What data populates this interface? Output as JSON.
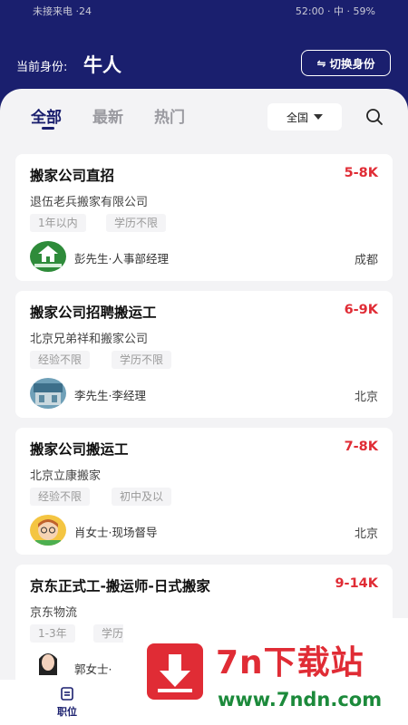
{
  "status": {
    "left": "未接来电 ·24",
    "right": "52:00 · 中 · 59%"
  },
  "header": {
    "identity_label": "当前身份:",
    "identity_value": "牛人",
    "switch_label": "切换身份",
    "switch_icon": "⇋"
  },
  "tabs": [
    {
      "label": "全部"
    },
    {
      "label": "最新"
    },
    {
      "label": "热门"
    }
  ],
  "region": {
    "label": "全国"
  },
  "jobs": [
    {
      "title": "搬家公司直招",
      "salary": "5-8K",
      "company": "退伍老兵搬家有限公司",
      "tags": [
        "1年以内",
        "学历不限"
      ],
      "recruiter": "彭先生·人事部经理",
      "city": "成都",
      "avatar": "logo"
    },
    {
      "title": "搬家公司招聘搬运工",
      "salary": "6-9K",
      "company": "北京兄弟祥和搬家公司",
      "tags": [
        "经验不限",
        "学历不限"
      ],
      "recruiter": "李先生·李经理",
      "city": "北京",
      "avatar": "photo"
    },
    {
      "title": "搬家公司搬运工",
      "salary": "7-8K",
      "company": "北京立康搬家",
      "tags": [
        "经验不限",
        "初中及以"
      ],
      "recruiter": "肖女士·现场督导",
      "city": "北京",
      "avatar": "cartoon"
    },
    {
      "title": "京东正式工-搬运师-日式搬家",
      "salary": "9-14K",
      "company": "京东物流",
      "tags": [
        "1-3年",
        "学历"
      ],
      "recruiter": "郭女士·",
      "city": "",
      "avatar": "person"
    }
  ],
  "nav": {
    "label": "职位"
  },
  "watermark": {
    "title": "7n下载站",
    "url": "www.7ndn.com"
  },
  "colors": {
    "primary": "#1a1f6e",
    "salary": "#e02c35",
    "background": "#f3f3f5"
  }
}
